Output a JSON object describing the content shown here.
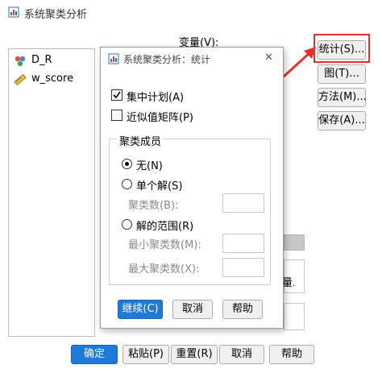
{
  "main_window": {
    "title": "系统聚类分析",
    "variables_label": "变量(V):",
    "source_vars": [
      {
        "name": "D_R",
        "icon": "nominal-var-icon"
      },
      {
        "name": "w_score",
        "icon": "scale-var-icon"
      }
    ],
    "right_buttons": [
      "统计(S)...",
      "图(T)...",
      "方法(M)...",
      "保存(A)..."
    ],
    "partial_label": "量",
    "partial_label_suffix": ".",
    "bottom_buttons": [
      "确定",
      "粘贴(P)",
      "重置(R)",
      "取消",
      "帮助"
    ]
  },
  "dialog": {
    "title": "系统聚类分析：统计",
    "close_glyph": "✕",
    "agglomeration_label": "集中计划(A)",
    "agglomeration_checked": true,
    "proximity_label": "近似值矩阵(P)",
    "proximity_checked": false,
    "group_title": "聚类成员",
    "radio_none": "无(N)",
    "radio_single": "单个解(S)",
    "clusters_label": "聚类数(B):",
    "radio_range": "解的范围(R)",
    "min_label": "最小聚类数(M):",
    "max_label": "最大聚类数(X):",
    "selected": "none",
    "continue_label": "继续(C)",
    "cancel_label": "取消",
    "help_label": "帮助"
  },
  "colors": {
    "highlight_red": "#e5302f",
    "primary_blue": "#1e7ad6"
  }
}
